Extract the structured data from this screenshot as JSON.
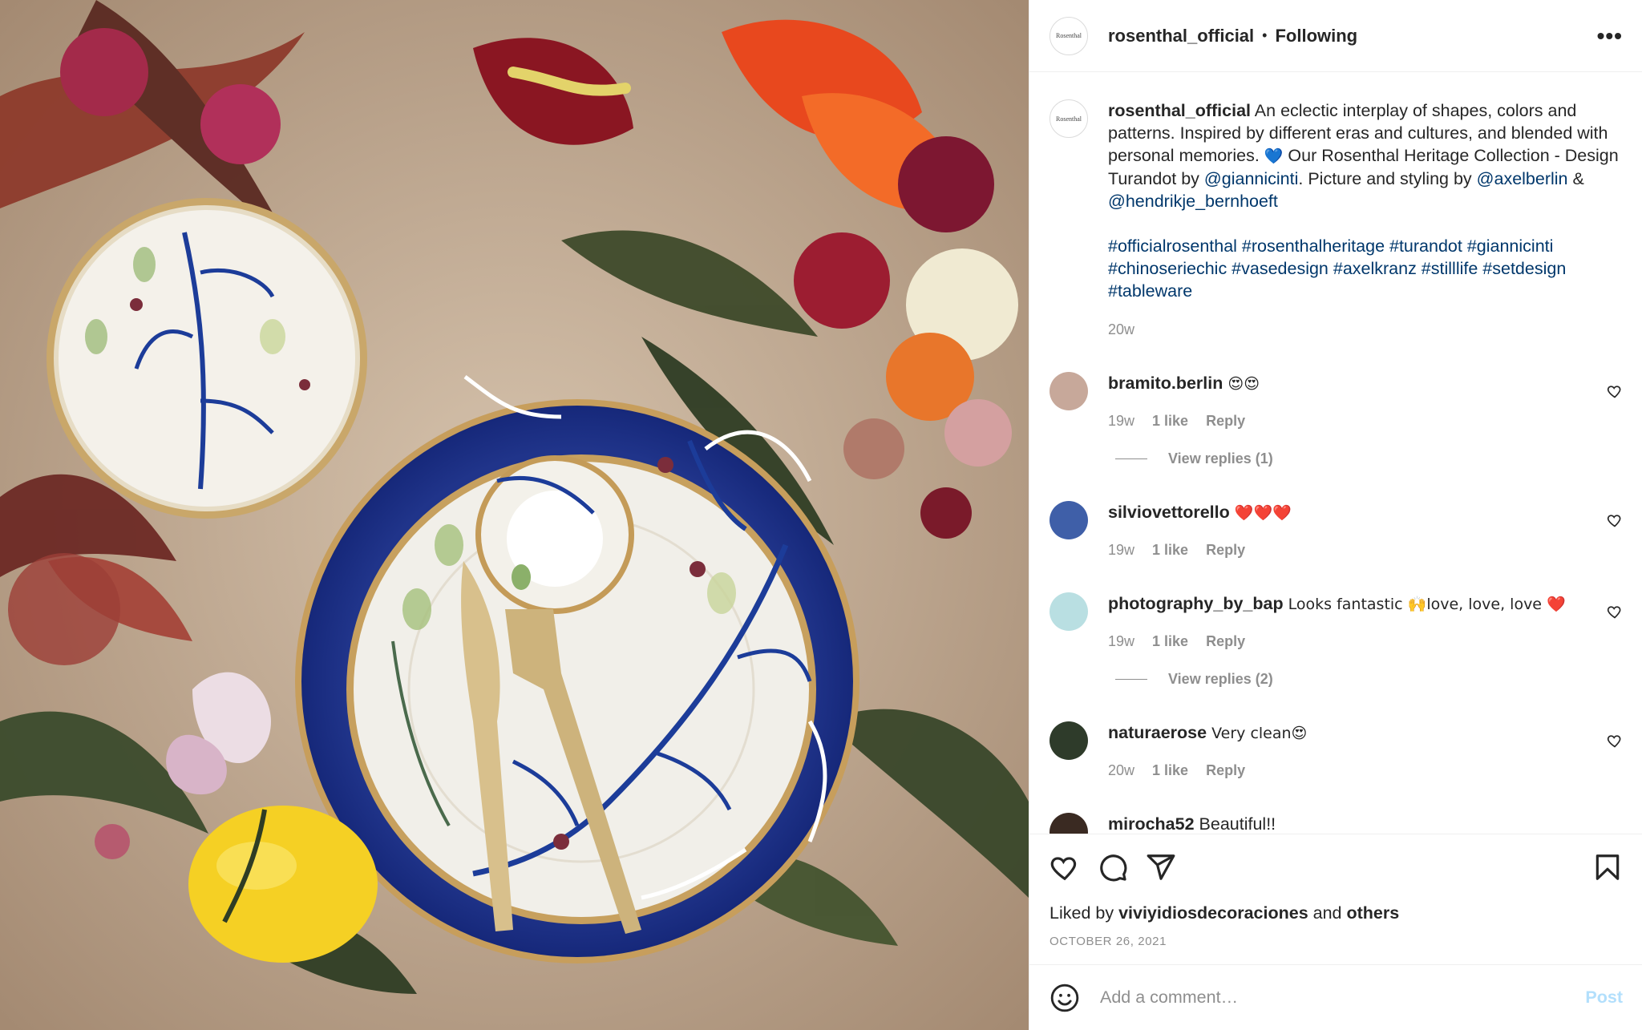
{
  "post": {
    "username": "rosenthal_official",
    "follow_state": "Following",
    "dot": "•",
    "more": "•••",
    "caption": {
      "t1": " An eclectic interplay of shapes, colors and patterns. Inspired by different eras and cultures, and blended with personal memories. ",
      "emoji": "💙",
      "t2": " Our Rosenthal Heritage Collection - Design Turandot by ",
      "m1": "@giannicinti",
      "t3": ". Picture and styling by ",
      "m2": "@axelberlin",
      "t4": " & ",
      "m3": "@hendrikje_bernhoeft"
    },
    "hashtags": "#officialrosenthal #rosenthalheritage #turandot #giannicinti #chinoseriechic #vasedesign #axelkranz #stilllife #setdesign #tableware",
    "time": "20w"
  },
  "comments": [
    {
      "user": "bramito.berlin",
      "text": " 😍😍",
      "time": "19w",
      "likes": "1 like",
      "reply": "Reply",
      "replies": "View replies (1)"
    },
    {
      "user": "silviovettorello",
      "text": " ❤️❤️❤️",
      "time": "19w",
      "likes": "1 like",
      "reply": "Reply",
      "replies": ""
    },
    {
      "user": "photography_by_bap",
      "text": " Looks fantastic 🙌love, love, love ❤️",
      "time": "19w",
      "likes": "1 like",
      "reply": "Reply",
      "replies": "View replies (2)"
    },
    {
      "user": "naturaerose",
      "text": " Very clean😍",
      "time": "20w",
      "likes": "1 like",
      "reply": "Reply",
      "replies": ""
    },
    {
      "user": "mirocha52",
      "text": " Beautiful!!",
      "time": "",
      "likes": "",
      "reply": "",
      "replies": ""
    }
  ],
  "footer": {
    "liked_prefix": "Liked by ",
    "liked_user": "viviyidiosdecoraciones",
    "liked_and": " and ",
    "liked_others": "others",
    "date": "OCTOBER 26, 2021",
    "comment_placeholder": "Add a comment…",
    "post_label": "Post"
  },
  "brand_mark": "Rosenthal",
  "icons": [
    "heart-icon",
    "comment-icon",
    "share-icon",
    "bookmark-icon",
    "emoji-icon",
    "more-icon"
  ]
}
